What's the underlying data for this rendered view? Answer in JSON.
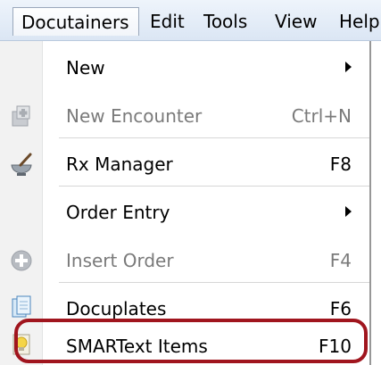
{
  "menubar": {
    "items": [
      {
        "label": "Docutainers"
      },
      {
        "label": "Edit"
      },
      {
        "label": "Tools"
      },
      {
        "label": "View"
      },
      {
        "label": "Help"
      }
    ]
  },
  "dropdown": {
    "items": [
      {
        "label": "New",
        "shortcut": "",
        "submenu": true,
        "enabled": true,
        "icon": "none"
      },
      {
        "label": "New Encounter",
        "shortcut": "Ctrl+N",
        "enabled": false,
        "icon": "new-encounter-icon"
      },
      {
        "label": "Rx Manager",
        "shortcut": "F8",
        "enabled": true,
        "icon": "mortar-pestle-icon"
      },
      {
        "label": "Order Entry",
        "shortcut": "",
        "submenu": true,
        "enabled": true,
        "icon": "none"
      },
      {
        "label": "Insert Order",
        "shortcut": "F4",
        "enabled": false,
        "icon": "plus-circle-icon"
      },
      {
        "label": "Docuplates",
        "shortcut": "F6",
        "enabled": true,
        "icon": "docuplates-icon"
      },
      {
        "label": "SMARText Items",
        "shortcut": "F10",
        "enabled": true,
        "icon": "lightbulb-icon"
      }
    ]
  },
  "colors": {
    "menubar_bg": "#dbe6f4",
    "highlight_border": "#a0151e",
    "disabled_text": "#7a7a7a"
  }
}
